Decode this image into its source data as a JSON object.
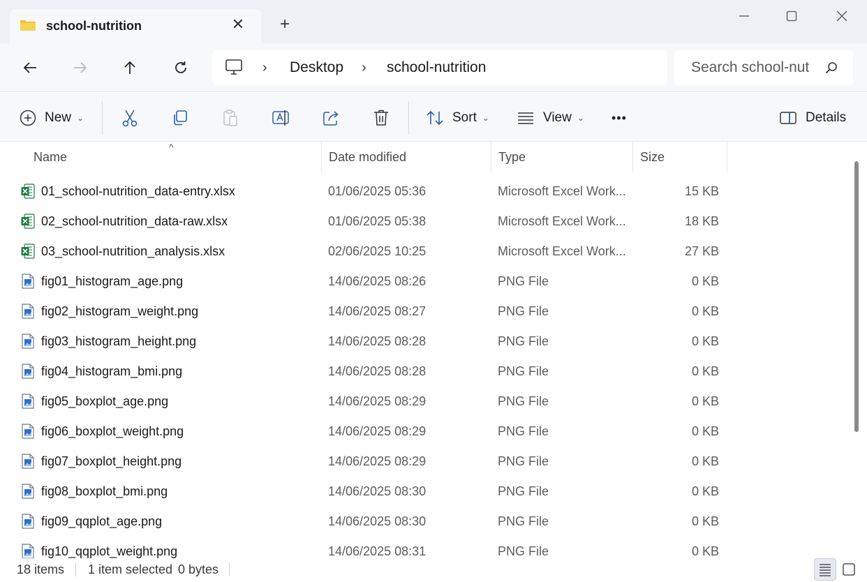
{
  "window": {
    "tab_title": "school-nutrition",
    "tab_close_glyph": "✕",
    "new_tab_glyph": "+",
    "controls": [
      "minimize-icon",
      "maximize-icon",
      "close-icon"
    ]
  },
  "nav": {
    "breadcrumb": [
      "Desktop",
      "school-nutrition"
    ],
    "breadcrumb_separator": "›",
    "search_placeholder": "Search school-nut"
  },
  "commands": {
    "new_label": "New",
    "sort_label": "Sort",
    "view_label": "View",
    "more_label": "•••",
    "details_label": "Details",
    "caret": "⌄"
  },
  "columns": {
    "name": "Name",
    "date": "Date modified",
    "type": "Type",
    "size": "Size",
    "sort_indicator": "^"
  },
  "files": [
    {
      "name": "01_school-nutrition_data-entry.xlsx",
      "date": "01/06/2025 05:36",
      "type": "Microsoft Excel Work...",
      "size": "15 KB",
      "kind": "excel"
    },
    {
      "name": "02_school-nutrition_data-raw.xlsx",
      "date": "01/06/2025 05:38",
      "type": "Microsoft Excel Work...",
      "size": "18 KB",
      "kind": "excel"
    },
    {
      "name": "03_school-nutrition_analysis.xlsx",
      "date": "02/06/2025 10:25",
      "type": "Microsoft Excel Work...",
      "size": "27 KB",
      "kind": "excel"
    },
    {
      "name": "fig01_histogram_age.png",
      "date": "14/06/2025 08:26",
      "type": "PNG File",
      "size": "0 KB",
      "kind": "png"
    },
    {
      "name": "fig02_histogram_weight.png",
      "date": "14/06/2025 08:27",
      "type": "PNG File",
      "size": "0 KB",
      "kind": "png"
    },
    {
      "name": "fig03_histogram_height.png",
      "date": "14/06/2025 08:28",
      "type": "PNG File",
      "size": "0 KB",
      "kind": "png"
    },
    {
      "name": "fig04_histogram_bmi.png",
      "date": "14/06/2025 08:28",
      "type": "PNG File",
      "size": "0 KB",
      "kind": "png"
    },
    {
      "name": "fig05_boxplot_age.png",
      "date": "14/06/2025 08:29",
      "type": "PNG File",
      "size": "0 KB",
      "kind": "png"
    },
    {
      "name": "fig06_boxplot_weight.png",
      "date": "14/06/2025 08:29",
      "type": "PNG File",
      "size": "0 KB",
      "kind": "png"
    },
    {
      "name": "fig07_boxplot_height.png",
      "date": "14/06/2025 08:29",
      "type": "PNG File",
      "size": "0 KB",
      "kind": "png"
    },
    {
      "name": "fig08_boxplot_bmi.png",
      "date": "14/06/2025 08:30",
      "type": "PNG File",
      "size": "0 KB",
      "kind": "png"
    },
    {
      "name": "fig09_qqplot_age.png",
      "date": "14/06/2025 08:30",
      "type": "PNG File",
      "size": "0 KB",
      "kind": "png"
    },
    {
      "name": "fig10_qqplot_weight.png",
      "date": "14/06/2025 08:31",
      "type": "PNG File",
      "size": "0 KB",
      "kind": "png"
    }
  ],
  "status": {
    "item_count": "18 items",
    "selection": "1 item selected",
    "selection_size": "0 bytes"
  },
  "colors": {
    "excel_green": "#1f7a43",
    "png_blue": "#2f6fc7",
    "folder_yellow": "#f2c12e",
    "chrome_bg": "#eef0f4"
  }
}
